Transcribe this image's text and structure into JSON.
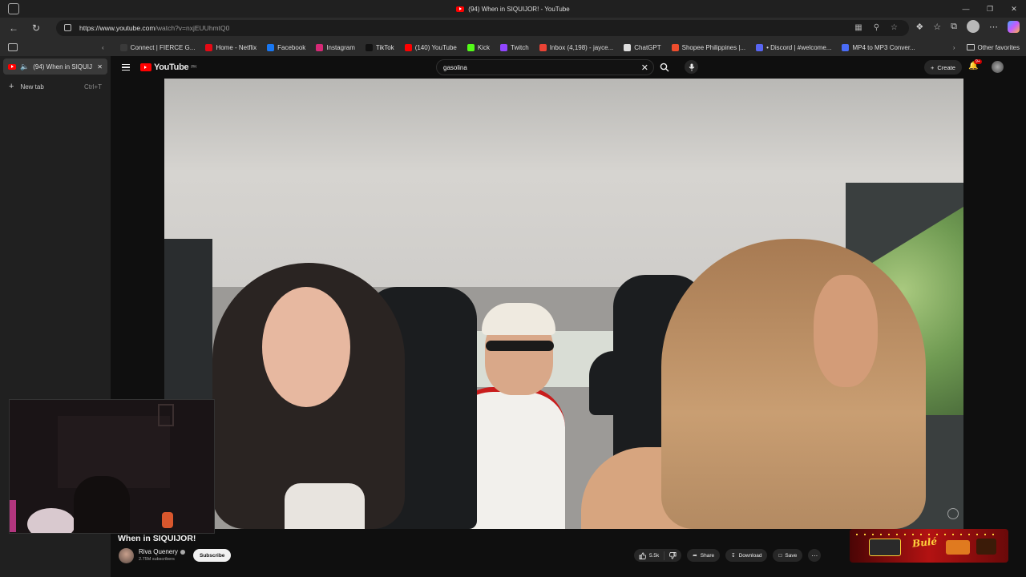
{
  "window": {
    "title": "(94) When in SIQUIJOR! - YouTube"
  },
  "address": {
    "url_host": "https://www.youtube.com",
    "url_path": "/watch?v=nxjEUUhmtQ0"
  },
  "favorites": [
    {
      "label": "Connect | FIERCE G...",
      "color": "#3a3a3a"
    },
    {
      "label": "Home - Netflix",
      "color": "#e50914"
    },
    {
      "label": "Facebook",
      "color": "#1877f2"
    },
    {
      "label": "Instagram",
      "color": "#d62976"
    },
    {
      "label": "TikTok",
      "color": "#111111"
    },
    {
      "label": "(140) YouTube",
      "color": "#ff0000"
    },
    {
      "label": "Kick",
      "color": "#53fc18"
    },
    {
      "label": "Twitch",
      "color": "#9146ff"
    },
    {
      "label": "Inbox (4,198) - jayce...",
      "color": "#ea4335"
    },
    {
      "label": "ChatGPT",
      "color": "#dddddd"
    },
    {
      "label": "Shopee Philippines |...",
      "color": "#ee4d2d"
    },
    {
      "label": "• Discord | #welcome...",
      "color": "#5865f2"
    },
    {
      "label": "MP4 to MP3 Conver...",
      "color": "#4a6cf7"
    }
  ],
  "other_favorites": "Other favorites",
  "sidebar": {
    "active_tab": "(94) When in SIQUIJ",
    "new_tab": "New tab",
    "new_tab_shortcut": "Ctrl+T"
  },
  "youtube": {
    "logo": "YouTube",
    "logo_region": "PH",
    "search_value": "gasolina",
    "create_label": "Create",
    "notif_count": "9+",
    "video_title": "When in SIQUIJOR!",
    "channel_name": "Riva Quenery",
    "subscribers": "2.75M subscribers",
    "subscribe_label": "Subscribe",
    "likes": "5.5k",
    "share_label": "Share",
    "download_label": "Download",
    "save_label": "Save",
    "ad_brand": "Bulé"
  },
  "colors": {
    "accent": "#ff0000",
    "bg": "#0f0f0f"
  }
}
